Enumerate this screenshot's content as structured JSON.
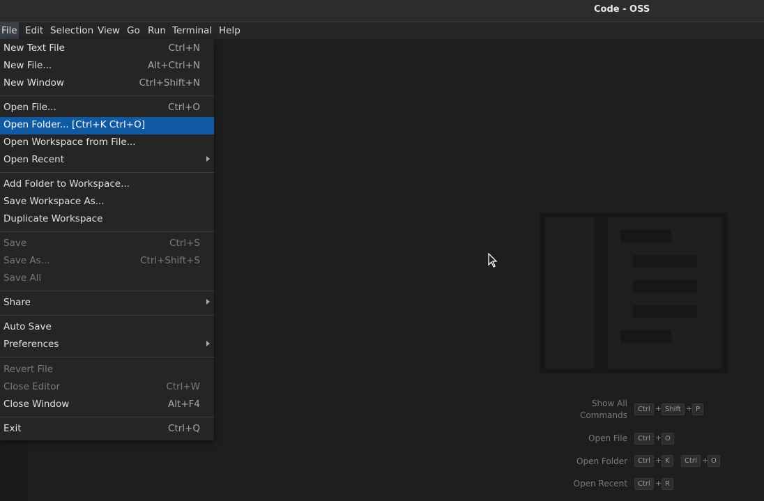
{
  "window": {
    "title": "Code - OSS"
  },
  "menubar": {
    "items": [
      "File",
      "Edit",
      "Selection",
      "View",
      "Go",
      "Run",
      "Terminal",
      "Help"
    ]
  },
  "file_menu": {
    "items": [
      {
        "label": "New Text File",
        "shortcut": "Ctrl+N"
      },
      {
        "label": "New File...",
        "shortcut": "Alt+Ctrl+N"
      },
      {
        "label": "New Window",
        "shortcut": "Ctrl+Shift+N"
      },
      {
        "label": "Open File...",
        "shortcut": "Ctrl+O"
      },
      {
        "label": "Open Folder... [Ctrl+K Ctrl+O]",
        "shortcut": ""
      },
      {
        "label": "Open Workspace from File...",
        "shortcut": ""
      },
      {
        "label": "Open Recent",
        "shortcut": ""
      },
      {
        "label": "Add Folder to Workspace...",
        "shortcut": ""
      },
      {
        "label": "Save Workspace As...",
        "shortcut": ""
      },
      {
        "label": "Duplicate Workspace",
        "shortcut": ""
      },
      {
        "label": "Save",
        "shortcut": "Ctrl+S"
      },
      {
        "label": "Save As...",
        "shortcut": "Ctrl+Shift+S"
      },
      {
        "label": "Save All",
        "shortcut": ""
      },
      {
        "label": "Share",
        "shortcut": ""
      },
      {
        "label": "Auto Save",
        "shortcut": ""
      },
      {
        "label": "Preferences",
        "shortcut": ""
      },
      {
        "label": "Revert File",
        "shortcut": ""
      },
      {
        "label": "Close Editor",
        "shortcut": "Ctrl+W"
      },
      {
        "label": "Close Window",
        "shortcut": "Alt+F4"
      },
      {
        "label": "Exit",
        "shortcut": "Ctrl+Q"
      }
    ]
  },
  "shortcuts": {
    "show_all_line1": "Show All",
    "show_all_line2": "Commands",
    "open_file": "Open File",
    "open_folder": "Open Folder",
    "open_recent": "Open Recent",
    "keys": {
      "ctrl": "Ctrl",
      "shift": "Shift",
      "p": "P",
      "o": "O",
      "k": "K",
      "r": "R",
      "plus": "+"
    }
  },
  "colors": {
    "highlight": "#0f5aa3",
    "menu_bg": "#252526",
    "editor_bg": "#1e1e1e"
  }
}
